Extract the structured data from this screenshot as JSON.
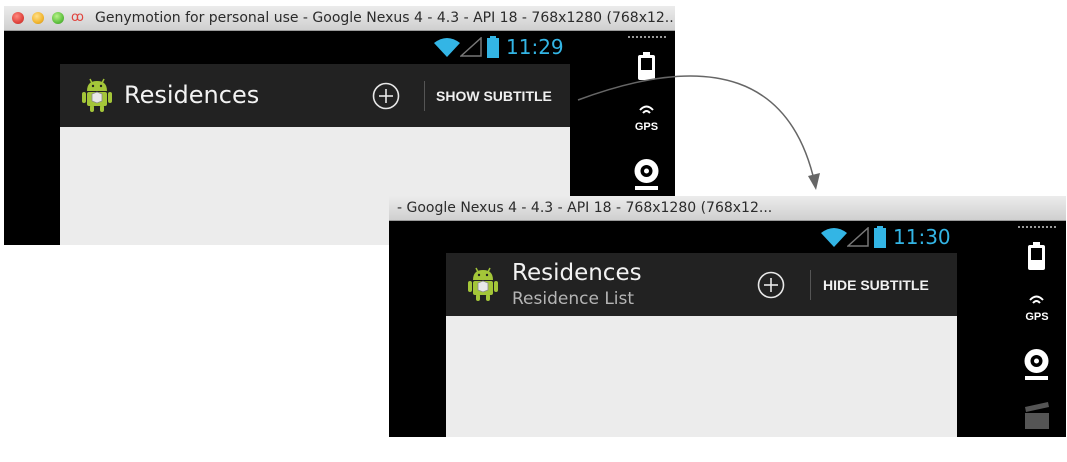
{
  "shots": [
    {
      "window_title": "Genymotion for personal use - Google Nexus 4 - 4.3 - API 18 - 768x1280 (768x12...",
      "clock": "11:29",
      "app_title": "Residences",
      "subtitle": "",
      "action_label": "SHOW SUBTITLE",
      "gps_label": "GPS"
    },
    {
      "window_title": "- Google Nexus 4 - 4.3 - API 18 - 768x1280 (768x12...",
      "clock": "11:30",
      "app_title": "Residences",
      "subtitle": "Residence List",
      "action_label": "HIDE SUBTITLE",
      "gps_label": "GPS"
    }
  ],
  "icons": {
    "status": [
      "wifi-icon",
      "signal-icon",
      "battery-icon"
    ],
    "actionbar": [
      "android-app-icon",
      "add-icon"
    ],
    "sidebar": [
      "battery-icon",
      "gps-icon",
      "webcam-icon",
      "clapperboard-icon"
    ]
  },
  "colors": {
    "clock": "#33b5e5",
    "actionbar": "#222222",
    "content": "#ececec",
    "android_green": "#a4c639"
  }
}
